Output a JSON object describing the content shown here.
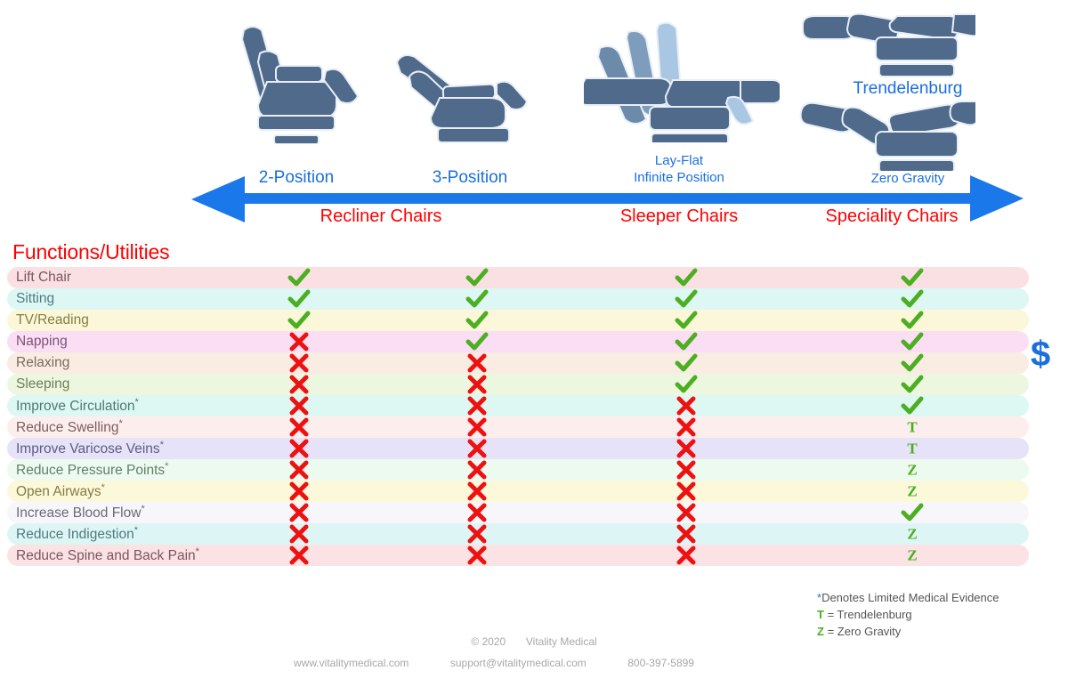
{
  "chairs": [
    {
      "name": "2-position-chair",
      "caption": "2-Position"
    },
    {
      "name": "3-position-chair",
      "caption": "3-Position"
    },
    {
      "name": "lay-flat-chair",
      "caption": "Lay-Flat\nInfinite Position"
    },
    {
      "name": "trendelenburg-chair",
      "caption": "Trendelenburg"
    },
    {
      "name": "zero-gravity-chair",
      "caption": "Zero Gravity"
    }
  ],
  "axis": {
    "dollar_low": "$",
    "dollar_high": "$",
    "positions": [
      {
        "label": "2-Position"
      },
      {
        "label": "3-Position"
      },
      {
        "label_line1": "Lay-Flat",
        "label_line2": "Infinite Position"
      },
      {
        "label": "Trendelenburg"
      },
      {
        "label": "Zero Gravity"
      }
    ],
    "categories": [
      {
        "label": "Recliner Chairs"
      },
      {
        "label": "Sleeper Chairs"
      },
      {
        "label": "Speciality Chairs"
      }
    ]
  },
  "table": {
    "heading": "Functions/Utilities",
    "columns": [
      "2-Position",
      "3-Position",
      "Lay-Flat Infinite Position",
      "Speciality"
    ],
    "rows": [
      {
        "label": "Lift Chair",
        "limited": false,
        "band": "#fbe0e3",
        "text": "#7a5560",
        "values": [
          "check",
          "check",
          "check",
          "check"
        ]
      },
      {
        "label": "Sitting",
        "limited": false,
        "band": "#ddf7f5",
        "text": "#4f7d80",
        "values": [
          "check",
          "check",
          "check",
          "check"
        ]
      },
      {
        "label": "TV/Reading",
        "limited": false,
        "band": "#fbf7d8",
        "text": "#857e45",
        "values": [
          "check",
          "check",
          "check",
          "check"
        ]
      },
      {
        "label": "Napping",
        "limited": false,
        "band": "#fbdef4",
        "text": "#7b5378",
        "values": [
          "cross",
          "check",
          "check",
          "check"
        ]
      },
      {
        "label": "Relaxing",
        "limited": false,
        "band": "#f8ece3",
        "text": "#7d6a5e",
        "values": [
          "cross",
          "cross",
          "check",
          "check"
        ]
      },
      {
        "label": "Sleeping",
        "limited": false,
        "band": "#edf7e0",
        "text": "#6e7d57",
        "values": [
          "cross",
          "cross",
          "check",
          "check"
        ]
      },
      {
        "label": "Improve Circulation",
        "limited": true,
        "band": "#ddf7f2",
        "text": "#4e7b74",
        "values": [
          "cross",
          "cross",
          "cross",
          "check"
        ]
      },
      {
        "label": "Reduce Swelling",
        "limited": true,
        "band": "#fdeeee",
        "text": "#7c5d5d",
        "values": [
          "cross",
          "cross",
          "cross",
          "T"
        ]
      },
      {
        "label": "Improve Varicose Veins",
        "limited": true,
        "band": "#e6e2f8",
        "text": "#5f5b85",
        "values": [
          "cross",
          "cross",
          "cross",
          "T"
        ]
      },
      {
        "label": "Reduce Pressure Points",
        "limited": true,
        "band": "#edfaef",
        "text": "#61806a",
        "values": [
          "cross",
          "cross",
          "cross",
          "Z"
        ]
      },
      {
        "label": "Open Airways",
        "limited": true,
        "band": "#fcf8da",
        "text": "#847c44",
        "values": [
          "cross",
          "cross",
          "cross",
          "Z"
        ]
      },
      {
        "label": "Increase Blood Flow",
        "limited": true,
        "band": "#f7f6fb",
        "text": "#6c6a78",
        "values": [
          "cross",
          "cross",
          "cross",
          "check"
        ]
      },
      {
        "label": "Reduce Indigestion",
        "limited": true,
        "band": "#ddf5f5",
        "text": "#4f7b7d",
        "values": [
          "cross",
          "cross",
          "cross",
          "Z"
        ]
      },
      {
        "label": "Reduce Spine and Back Pain",
        "limited": true,
        "band": "#fbe2e4",
        "text": "#7c5661",
        "values": [
          "cross",
          "cross",
          "cross",
          "Z"
        ]
      }
    ]
  },
  "legend": {
    "asterisk_symbol": "*",
    "asterisk_text": "Denotes Limited Medical Evidence",
    "t_key": "T",
    "t_text": "= Trendelenburg",
    "z_key": "Z",
    "z_text": "= Zero Gravity"
  },
  "footer": {
    "copyright": "© 2020",
    "company": "Vitality Medical",
    "website": "www.vitalitymedical.com",
    "email": "support@vitalitymedical.com",
    "phone": "800-397-5899"
  },
  "colors": {
    "accent_blue": "#1a6fe0",
    "category_red": "#ff0000",
    "check_green": "#4caf22",
    "cross_red": "#ee1111",
    "chair_dark": "#4f6a8a",
    "chair_mid": "#7e9cbb",
    "chair_light": "#a9c6e3"
  }
}
